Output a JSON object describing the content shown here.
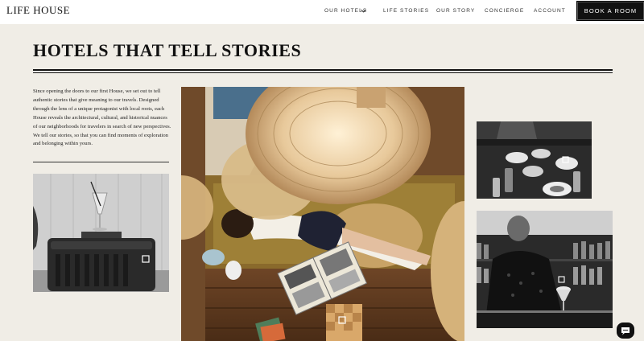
{
  "brand": {
    "logo_text": "LIFE HOUSE"
  },
  "nav": {
    "items": [
      {
        "label": "OUR HOTELS"
      },
      {
        "label": "LIFE STORIES"
      },
      {
        "label": "OUR STORY"
      },
      {
        "label": "CONCIERGE"
      },
      {
        "label": "ACCOUNT"
      }
    ],
    "book_label": "BOOK A ROOM"
  },
  "main": {
    "title": "HOTELS THAT TELL STORIES",
    "intro": "Since opening the doors to our first House, we set out to tell authentic stories that give meaning to our travels. Designed through the lens of a unique protagonist with local roots, each House reveals the architectural, cultural, and historical nuances of our neighborhoods for travelers in search of new perspectives. We tell our stories, so that you can find moments of exploration and belonging within yours."
  },
  "icons": {
    "dropdown": "chevron-down-icon",
    "chat": "chat-bubble-icon",
    "photo_tag": "square-tag-icon"
  },
  "colors": {
    "page_bg": "#f0ede6",
    "nav_bg": "#ffffff",
    "button_bg": "#111111",
    "text": "#1a1a1a"
  }
}
